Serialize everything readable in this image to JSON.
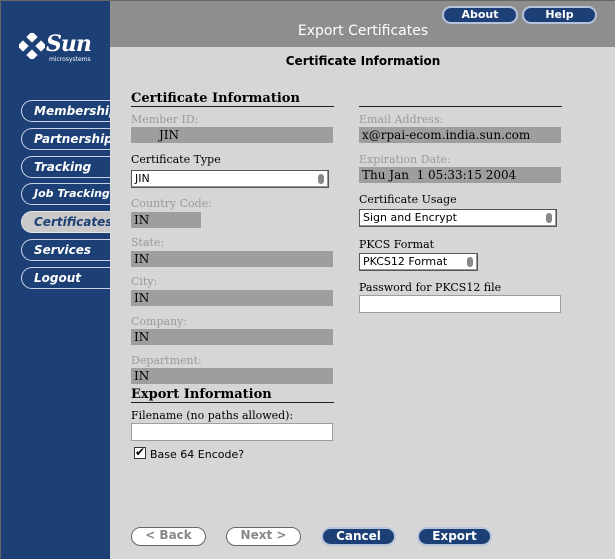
{
  "window": {
    "title": "Export Certificates"
  },
  "header": {
    "about_label": "About",
    "help_label": "Help"
  },
  "brand": {
    "name": "Sun",
    "tagline": "microsystems"
  },
  "sidebar": {
    "items": [
      {
        "label": "Membership",
        "active": false
      },
      {
        "label": "Partnership",
        "active": false
      },
      {
        "label": "Tracking",
        "active": false
      },
      {
        "label": "Job Tracking",
        "active": false
      },
      {
        "label": "Certificates",
        "active": true
      },
      {
        "label": "Services",
        "active": false
      },
      {
        "label": "Logout",
        "active": false
      }
    ]
  },
  "pane": {
    "title": "Certificate Information"
  },
  "cert": {
    "section": "Certificate Information",
    "member_id_label": "Member ID:",
    "member_id": "JIN",
    "cert_type_label": "Certificate Type",
    "cert_type": "JIN",
    "country_label": "Country Code:",
    "country": "IN",
    "state_label": "State:",
    "state": "IN",
    "city_label": "City:",
    "city": "IN",
    "company_label": "Company:",
    "company": "IN",
    "department_label": "Department:",
    "department": "IN",
    "email_label": "Email Address:",
    "email": "x@rpai-ecom.india.sun.com",
    "expiration_label": "Expiration Date:",
    "expiration": "Thu Jan  1 05:33:15 2004",
    "usage_label": "Certificate Usage",
    "usage": "Sign and Encrypt",
    "pkcs_label": "PKCS Format",
    "pkcs": "PKCS12 Format",
    "password_label": "Password for PKCS12 file",
    "password": ""
  },
  "export": {
    "section": "Export Information",
    "filename_label": "Filename (no paths allowed):",
    "filename": "",
    "base64_label": "Base 64 Encode?",
    "base64_checked": true
  },
  "footer": {
    "back": "< Back",
    "next": "Next >",
    "cancel": "Cancel",
    "export": "Export"
  },
  "colors": {
    "nav_bg": "#1c3f75",
    "topbar": "#8e8e8e",
    "content": "#d6d6d6",
    "readonly": "#9e9e9e"
  }
}
